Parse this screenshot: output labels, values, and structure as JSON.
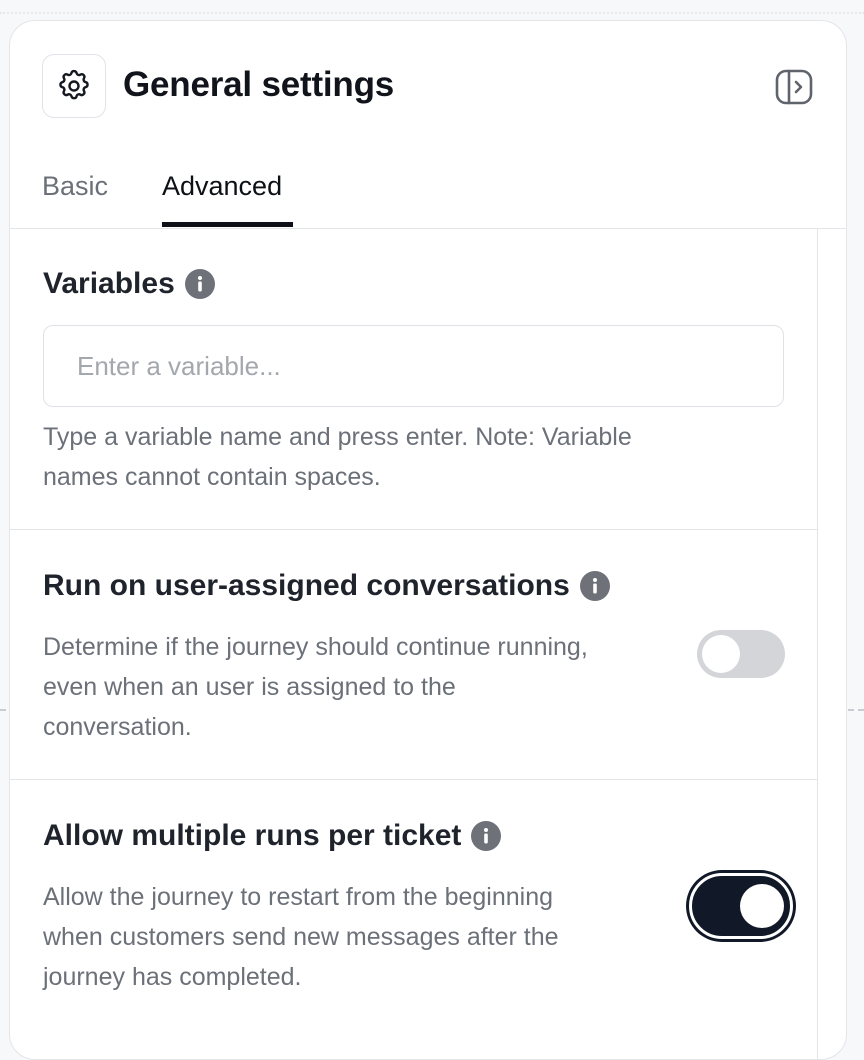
{
  "header": {
    "title": "General settings",
    "icon": "gear-icon",
    "collapse_icon": "panel-collapse-icon"
  },
  "tabs": [
    {
      "label": "Basic",
      "active": false
    },
    {
      "label": "Advanced",
      "active": true
    }
  ],
  "variables": {
    "title": "Variables",
    "placeholder": "Enter a variable...",
    "value": "",
    "help_line1": "Type a variable name and press enter. Note: Variable",
    "help_line2": "names cannot contain spaces."
  },
  "run_on_assigned": {
    "title": "Run on user-assigned conversations",
    "desc_line1": "Determine if the journey should continue running,",
    "desc_line2": "even when an user is assigned to the",
    "desc_line3": "conversation.",
    "enabled": false
  },
  "multiple_runs": {
    "title": "Allow multiple runs per ticket",
    "desc_line1": "Allow the journey to restart from the beginning",
    "desc_line2": "when customers send new messages after the",
    "desc_line3": "journey has completed.",
    "enabled": true
  },
  "colors": {
    "accent": "#111827",
    "muted_text": "#6b7079",
    "toggle_off": "#d3d5d9"
  }
}
